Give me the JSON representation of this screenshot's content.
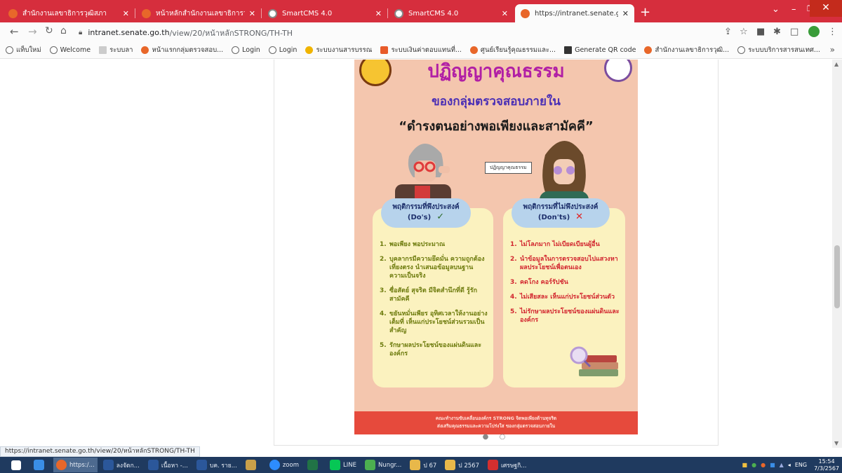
{
  "browser": {
    "tabs": [
      {
        "title": "สำนักงานเลขาธิการวุฒิสภา",
        "icon": "senate-icon",
        "active": false
      },
      {
        "title": "หน้าหลักสำนักงานเลขาธิการวุฒิสภา",
        "icon": "senate-icon",
        "active": false
      },
      {
        "title": "SmartCMS 4.0",
        "icon": "globe-icon",
        "active": false
      },
      {
        "title": "SmartCMS 4.0",
        "icon": "globe-icon",
        "active": false
      },
      {
        "title": "https://intranet.senate.go.th/vie",
        "icon": "senate-icon",
        "active": true
      }
    ],
    "new_tab": "+",
    "address": {
      "host": "intranet.senate.go.th",
      "path": "/view/20/หน้าหลักSTRONG/TH-TH"
    },
    "bookmarks": [
      {
        "label": "แท็บใหม่",
        "icon": "globe-icon"
      },
      {
        "label": "Welcome",
        "icon": "globe-icon"
      },
      {
        "label": "ระบบลา",
        "icon": "blank-page-icon"
      },
      {
        "label": "หน้าแรกกลุ่มตรวจสอบ...",
        "icon": "senate-icon"
      },
      {
        "label": "Login",
        "icon": "globe-icon"
      },
      {
        "label": "Login",
        "icon": "globe-icon"
      },
      {
        "label": "ระบบงานสารบรรณ",
        "icon": "yellow-circle-icon"
      },
      {
        "label": "ระบบเงินค่าตอบแทนที่...",
        "icon": "calendar-icon"
      },
      {
        "label": "ศูนย์เรียนรู้คุณธรรมและ...",
        "icon": "senate-icon"
      },
      {
        "label": "Generate QR code",
        "icon": "qr-icon"
      },
      {
        "label": "สำนักงานเลขาธิการวุฒิ...",
        "icon": "senate-icon"
      },
      {
        "label": "ระบบบริการสารสนเทศ...",
        "icon": "globe-icon"
      }
    ],
    "more": "»",
    "status_url": "https://intranet.senate.go.th/view/20/หน้าหลักSTRONG/TH-TH"
  },
  "poster": {
    "title": "ปฏิญญาคุณธรรม",
    "subtitle": "ของกลุ่มตรวจสอบภายใน",
    "motto": "“ดำรงตนอย่างพอเพียงและสามัคคี”",
    "figure_label": "ปฏิญญาคุณธรรม",
    "dos": {
      "heading": "พฤติกรรมที่พึงประสงค์",
      "heading_en": "(Do's)",
      "mark": "✓",
      "items": [
        {
          "num": "1.",
          "text": "พอเพียง พอประมาณ"
        },
        {
          "num": "2.",
          "text": "บุคลากรมีความยึดมั่น ความถูกต้อง เที่ยงตรง นำเสนอข้อมูลบนฐานความเป็นจริง"
        },
        {
          "num": "3.",
          "text": "ซื่อสัตย์ สุจริต มีจิตสำนึกที่ดี รู้รักสามัคคี"
        },
        {
          "num": "4.",
          "text": "ขยันหมั่นเพียร อุทิศเวลาให้งานอย่างเต็มที่ เห็นแก่ประโยชน์ส่วนรวมเป็นสำคัญ"
        },
        {
          "num": "5.",
          "text": "รักษาผลประโยชน์ของแผ่นดินและองค์กร"
        }
      ]
    },
    "donts": {
      "heading": "พฤติกรรมที่ไม่พึงประสงค์",
      "heading_en": "(Don'ts)",
      "mark": "✕",
      "items": [
        {
          "num": "1.",
          "text": "ไม่โลภมาก ไม่เบียดเบียนผู้อื่น"
        },
        {
          "num": "2.",
          "text": "นำข้อมูลในการตรวจสอบไปแสวงหาผลประโยชน์เพื่อตนเอง"
        },
        {
          "num": "3.",
          "text": "คดโกง คอร์รัปชัน"
        },
        {
          "num": "4.",
          "text": "ไม่เสียสละ เห็นแก่ประโยชน์ส่วนตัว"
        },
        {
          "num": "5.",
          "text": "ไม่รักษาผลประโยชน์ของแผ่นดินและองค์กร"
        }
      ]
    },
    "footer_line1": "คณะทำงานขับเคลื่อนองค์กร STRONG จิตพอเพียงต้านทุจริต",
    "footer_line2": "ส่งเสริมคุณธรรมและความโปร่งใส ของกลุ่มตรวจสอบภายใน",
    "carousel_dots": "● ○"
  },
  "taskbar": {
    "apps": [
      {
        "label": "",
        "icon": "windows-start-icon",
        "color": "#ffffff"
      },
      {
        "label": "",
        "icon": "ie-icon",
        "color": "#3a8ee6"
      },
      {
        "label": "https:/...",
        "icon": "chrome-icon",
        "color": "#e8672a",
        "active": true
      },
      {
        "label": "ลงจัดก...",
        "icon": "word-icon",
        "color": "#2b579a"
      },
      {
        "label": "เนื้อหา -...",
        "icon": "word-icon",
        "color": "#2b579a"
      },
      {
        "label": "บค. ราย...",
        "icon": "word-icon",
        "color": "#2b579a"
      },
      {
        "label": "",
        "icon": "paint-icon",
        "color": "#c9a04a"
      },
      {
        "label": "zoom",
        "icon": "zoom-icon",
        "color": "#2d8cff"
      },
      {
        "label": "",
        "icon": "excel-icon",
        "color": "#217346"
      },
      {
        "label": "LINE",
        "icon": "line-icon",
        "color": "#06c755"
      },
      {
        "label": "Nungr...",
        "icon": "user-icon",
        "color": "#4caf50"
      },
      {
        "label": "ป 67",
        "icon": "folder-icon",
        "color": "#e8b84a"
      },
      {
        "label": "ป 2567",
        "icon": "folder-icon",
        "color": "#e8b84a"
      },
      {
        "label": "เศรษฐกิ...",
        "icon": "pdf-icon",
        "color": "#d32f2f"
      }
    ],
    "lang": "ENG",
    "time": "15:54",
    "date": "7/3/2567"
  }
}
